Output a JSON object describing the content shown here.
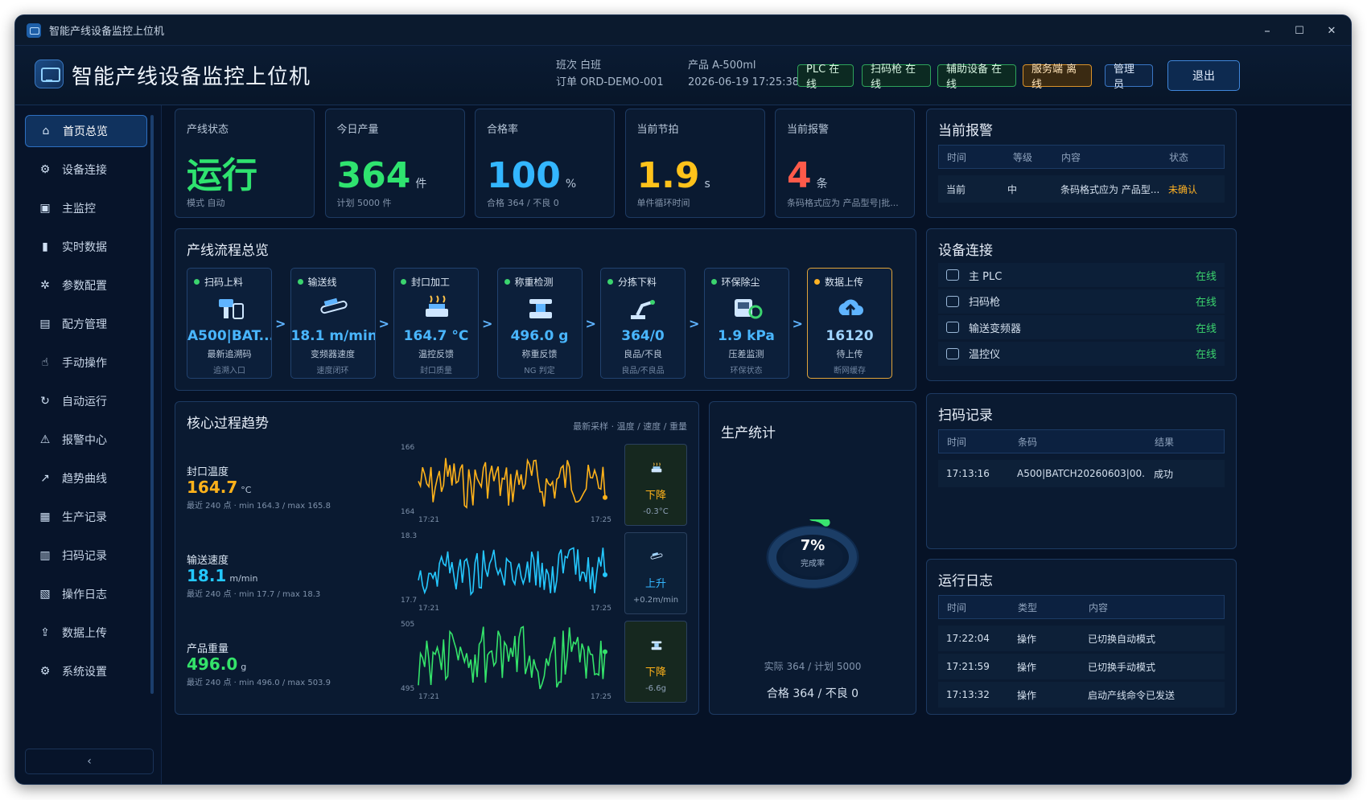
{
  "window": {
    "title": "智能产线设备监控上位机",
    "minimize": "–",
    "maximize": "☐",
    "close": "✕"
  },
  "header": {
    "title": "智能产线设备监控上位机",
    "shift": "班次 白班",
    "order": "订单 ORD-DEMO-001",
    "product": "产品 A-500ml",
    "datetime": "2026-06-19 17:25:38",
    "badges": [
      "PLC 在线",
      "扫码枪 在线",
      "辅助设备 在线",
      "服务端 离线"
    ],
    "user": "管理员",
    "logout": "退出"
  },
  "sidebar": {
    "items": [
      {
        "label": "首页总览",
        "icon": "home-icon",
        "glyph": "⌂"
      },
      {
        "label": "设备连接",
        "icon": "device-connect-icon",
        "glyph": "⚙"
      },
      {
        "label": "主监控",
        "icon": "monitor-icon",
        "glyph": "▣"
      },
      {
        "label": "实时数据",
        "icon": "bar-chart-icon",
        "glyph": "▮"
      },
      {
        "label": "参数配置",
        "icon": "gear-icon",
        "glyph": "✲"
      },
      {
        "label": "配方管理",
        "icon": "recipe-icon",
        "glyph": "▤"
      },
      {
        "label": "手动操作",
        "icon": "hand-icon",
        "glyph": "☝"
      },
      {
        "label": "自动运行",
        "icon": "refresh-icon",
        "glyph": "↻"
      },
      {
        "label": "报警中心",
        "icon": "warning-icon",
        "glyph": "⚠"
      },
      {
        "label": "趋势曲线",
        "icon": "line-chart-icon",
        "glyph": "↗"
      },
      {
        "label": "生产记录",
        "icon": "record-icon",
        "glyph": "▦"
      },
      {
        "label": "扫码记录",
        "icon": "barcode-icon",
        "glyph": "▥"
      },
      {
        "label": "操作日志",
        "icon": "log-icon",
        "glyph": "▧"
      },
      {
        "label": "数据上传",
        "icon": "upload-icon",
        "glyph": "⇪"
      },
      {
        "label": "系统设置",
        "icon": "settings-icon",
        "glyph": "⚙"
      }
    ],
    "collapse": "‹"
  },
  "kpis": [
    {
      "label": "产线状态",
      "value": "运行",
      "unit": "",
      "sub": "模式 自动",
      "color": "#2fe36f"
    },
    {
      "label": "今日产量",
      "value": "364",
      "unit": "件",
      "sub": "计划 5000 件",
      "color": "#2fe36f"
    },
    {
      "label": "合格率",
      "value": "100",
      "unit": "%",
      "sub": "合格 364 / 不良 0",
      "color": "#33b6ff"
    },
    {
      "label": "当前节拍",
      "value": "1.9",
      "unit": "s",
      "sub": "单件循环时间",
      "color": "#ffc21a"
    },
    {
      "label": "当前报警",
      "value": "4",
      "unit": "条",
      "sub": "条码格式应为 产品型号|批...",
      "color": "#ff5a4a"
    }
  ],
  "alarms": {
    "title": "当前报警",
    "headers": [
      "时间",
      "等级",
      "内容",
      "状态"
    ],
    "rows": [
      {
        "time": "当前",
        "level": "中",
        "content": "条码格式应为 产品型...",
        "status": "未确认"
      }
    ]
  },
  "process": {
    "title": "产线流程总览",
    "steps": [
      {
        "name": "扫码上料",
        "value": "A500|BAT...",
        "label": "最新追溯码",
        "note": "追溯入口",
        "icon": "scanner-icon"
      },
      {
        "name": "输送线",
        "value": "18.1 m/min",
        "label": "变频器速度",
        "note": "速度闭环",
        "icon": "conveyor-icon"
      },
      {
        "name": "封口加工",
        "value": "164.7 °C",
        "label": "温控反馈",
        "note": "封口质量",
        "icon": "sealer-icon"
      },
      {
        "name": "称重检测",
        "value": "496.0 g",
        "label": "称重反馈",
        "note": "NG 判定",
        "icon": "scale-icon"
      },
      {
        "name": "分拣下料",
        "value": "364/0",
        "label": "良品/不良",
        "note": "良品/不良品",
        "icon": "robot-arm-icon"
      },
      {
        "name": "环保除尘",
        "value": "1.9 kPa",
        "label": "压差监测",
        "note": "环保状态",
        "icon": "dust-collector-icon"
      },
      {
        "name": "数据上传",
        "value": "16120",
        "label": "待上传",
        "note": "断网缓存",
        "icon": "cloud-upload-icon"
      }
    ],
    "arrow": ">"
  },
  "trends": {
    "title": "核心过程趋势",
    "subtitle": "最新采样 · 温度 / 速度 / 重量",
    "items": [
      {
        "name": "封口温度",
        "value": "164.7",
        "unit": "°C",
        "sub": "最近 240 点 · min 164.3 / max 165.8",
        "ymax": "166",
        "ymin": "164",
        "xstart": "17:21",
        "xend": "17:25",
        "dir": "下降",
        "delta": "-0.3°C",
        "color": "#ffb21a",
        "icon": "sealer-icon"
      },
      {
        "name": "输送速度",
        "value": "18.1",
        "unit": "m/min",
        "sub": "最近 240 点 · min 17.7 / max 18.3",
        "ymax": "18.3",
        "ymin": "17.7",
        "xstart": "17:21",
        "xend": "17:25",
        "dir": "上升",
        "delta": "+0.2m/min",
        "color": "#24c8ff",
        "icon": "conveyor-icon"
      },
      {
        "name": "产品重量",
        "value": "496.0",
        "unit": "g",
        "sub": "最近 240 点 · min 496.0 / max 503.9",
        "ymax": "505",
        "ymin": "495",
        "xstart": "17:21",
        "xend": "17:25",
        "dir": "下降",
        "delta": "-6.6g",
        "color": "#34e36a",
        "icon": "scale-icon"
      }
    ]
  },
  "production": {
    "title": "生产统计",
    "percent": "7%",
    "percent_value": 7,
    "percent_label": "完成率",
    "plan_text": "实际 364 / 计划 5000",
    "quality_text": "合格 364 / 不良 0"
  },
  "devices": {
    "title": "设备连接",
    "rows": [
      {
        "name": "主 PLC",
        "status": "在线"
      },
      {
        "name": "扫码枪",
        "status": "在线"
      },
      {
        "name": "输送变频器",
        "status": "在线"
      },
      {
        "name": "温控仪",
        "status": "在线"
      }
    ]
  },
  "scans": {
    "title": "扫码记录",
    "headers": [
      "时间",
      "条码",
      "结果"
    ],
    "rows": [
      {
        "time": "17:13:16",
        "code": "A500|BATCH20260603|00...",
        "result": "成功"
      }
    ]
  },
  "logs": {
    "title": "运行日志",
    "headers": [
      "时间",
      "类型",
      "内容"
    ],
    "rows": [
      {
        "time": "17:22:04",
        "type": "操作",
        "content": "已切换自动模式"
      },
      {
        "time": "17:21:59",
        "type": "操作",
        "content": "已切换手动模式"
      },
      {
        "time": "17:13:32",
        "type": "操作",
        "content": "启动产线命令已发送"
      }
    ]
  }
}
